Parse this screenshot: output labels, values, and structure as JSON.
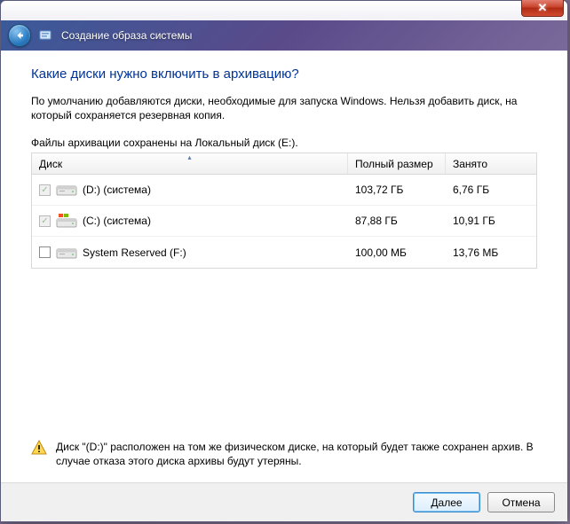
{
  "window": {
    "title": "Создание образа системы"
  },
  "page": {
    "heading": "Какие диски нужно включить в архивацию?",
    "description": "По умолчанию добавляются диски, необходимые для запуска Windows. Нельзя добавить диск, на который сохраняется резервная копия.",
    "save_location": "Файлы архивации сохранены на Локальный диск (E:)."
  },
  "table": {
    "headers": {
      "disk": "Диск",
      "full_size": "Полный размер",
      "used": "Занято"
    },
    "rows": [
      {
        "checked": true,
        "disabled": true,
        "icon": "plain",
        "label": "(D:) (система)",
        "size": "103,72 ГБ",
        "used": "6,76 ГБ"
      },
      {
        "checked": true,
        "disabled": true,
        "icon": "windows",
        "label": "(C:) (система)",
        "size": "87,88 ГБ",
        "used": "10,91 ГБ"
      },
      {
        "checked": false,
        "disabled": false,
        "icon": "plain",
        "label": "System Reserved (F:)",
        "size": "100,00 МБ",
        "used": "13,76 МБ"
      }
    ]
  },
  "warning": {
    "text": "Диск \"(D:)\" расположен на том же физическом диске, на который будет также сохранен архив. В случае отказа этого диска архивы будут утеряны."
  },
  "buttons": {
    "next": "Далее",
    "cancel": "Отмена"
  }
}
